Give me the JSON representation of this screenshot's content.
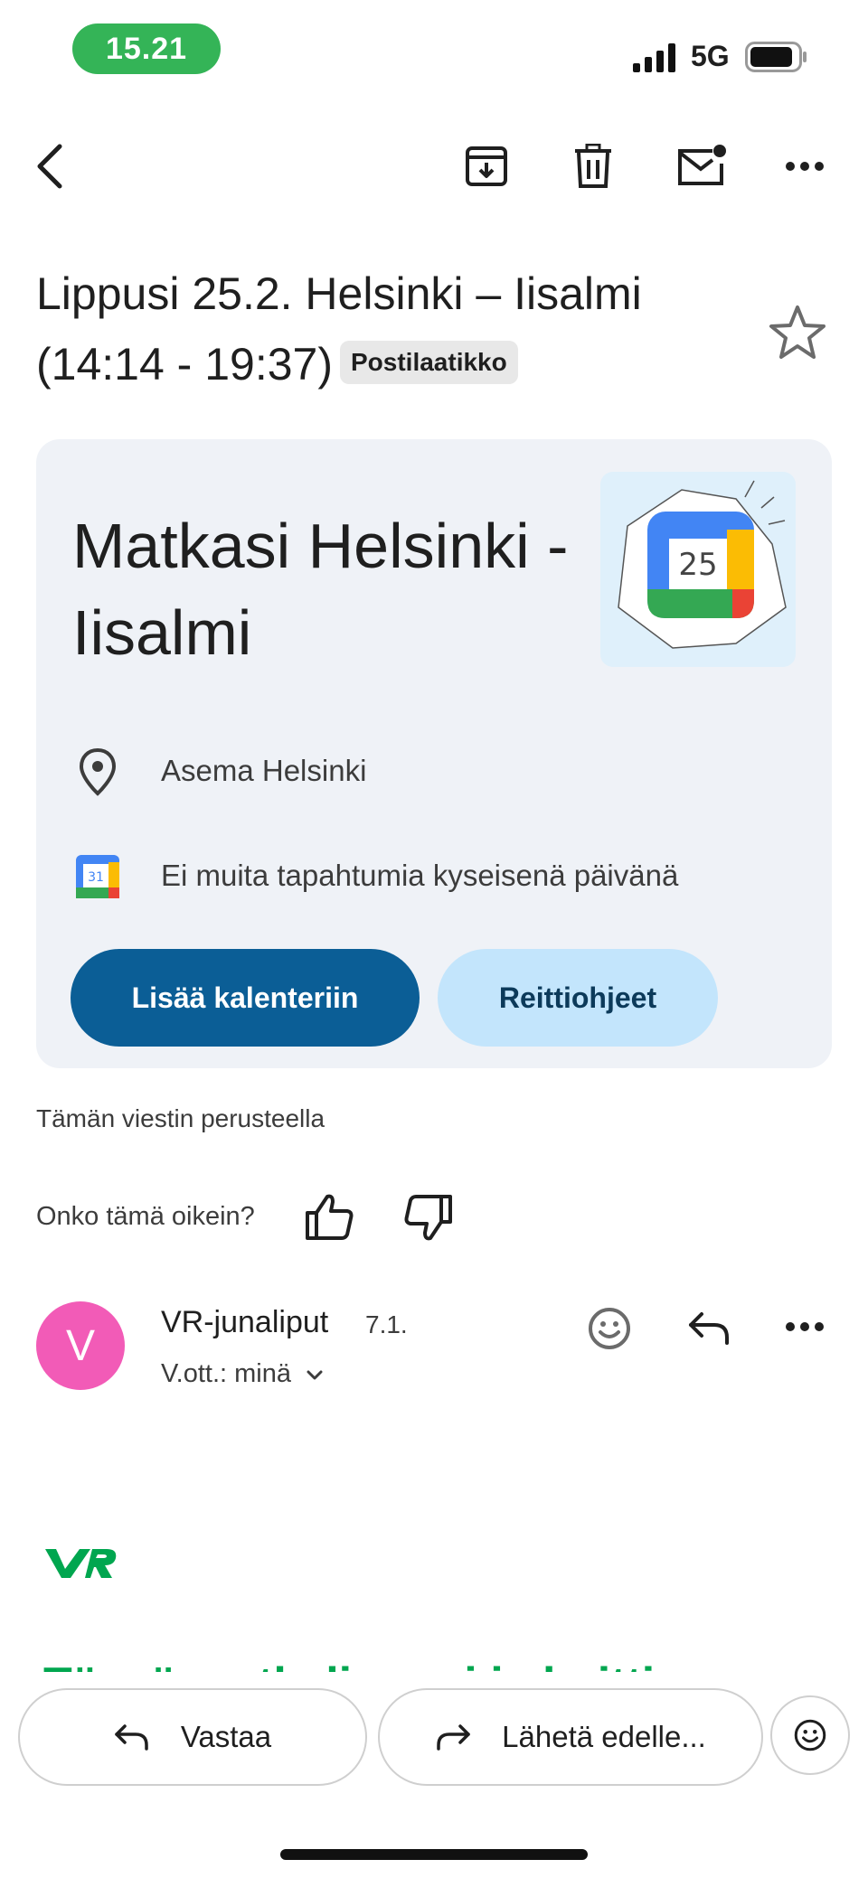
{
  "status_bar": {
    "time": "15.21",
    "network": "5G"
  },
  "subject": {
    "title": "Lippusi 25.2. Helsinki – Iisalmi (14:14 - 19:37)",
    "label": "Postilaatikko"
  },
  "smart_card": {
    "title": "Matkasi Helsinki - Iisalmi",
    "location": "Asema Helsinki",
    "calendar_note": "Ei muita tapahtumia kyseisenä päivänä",
    "calendar_icon_day": "31",
    "illustration_day": "25",
    "primary_button": "Lisää kalenteriin",
    "secondary_button": "Reittiohjeet"
  },
  "note": "Tämän viestin perusteella",
  "feedback": {
    "question": "Onko tämä oikein?"
  },
  "message": {
    "avatar_letter": "V",
    "sender": "VR-junaliput",
    "date": "7.1.",
    "recipient": "V.ott.: minä",
    "body_heading": "Tässä matkalippusi ja kuitti"
  },
  "bottom_bar": {
    "reply": "Vastaa",
    "forward": "Lähetä edelle..."
  },
  "colors": {
    "accent": "#0b5e96",
    "avatar": "#f25bb7",
    "vr_green": "#00a64f",
    "time_pill": "#34b457"
  }
}
